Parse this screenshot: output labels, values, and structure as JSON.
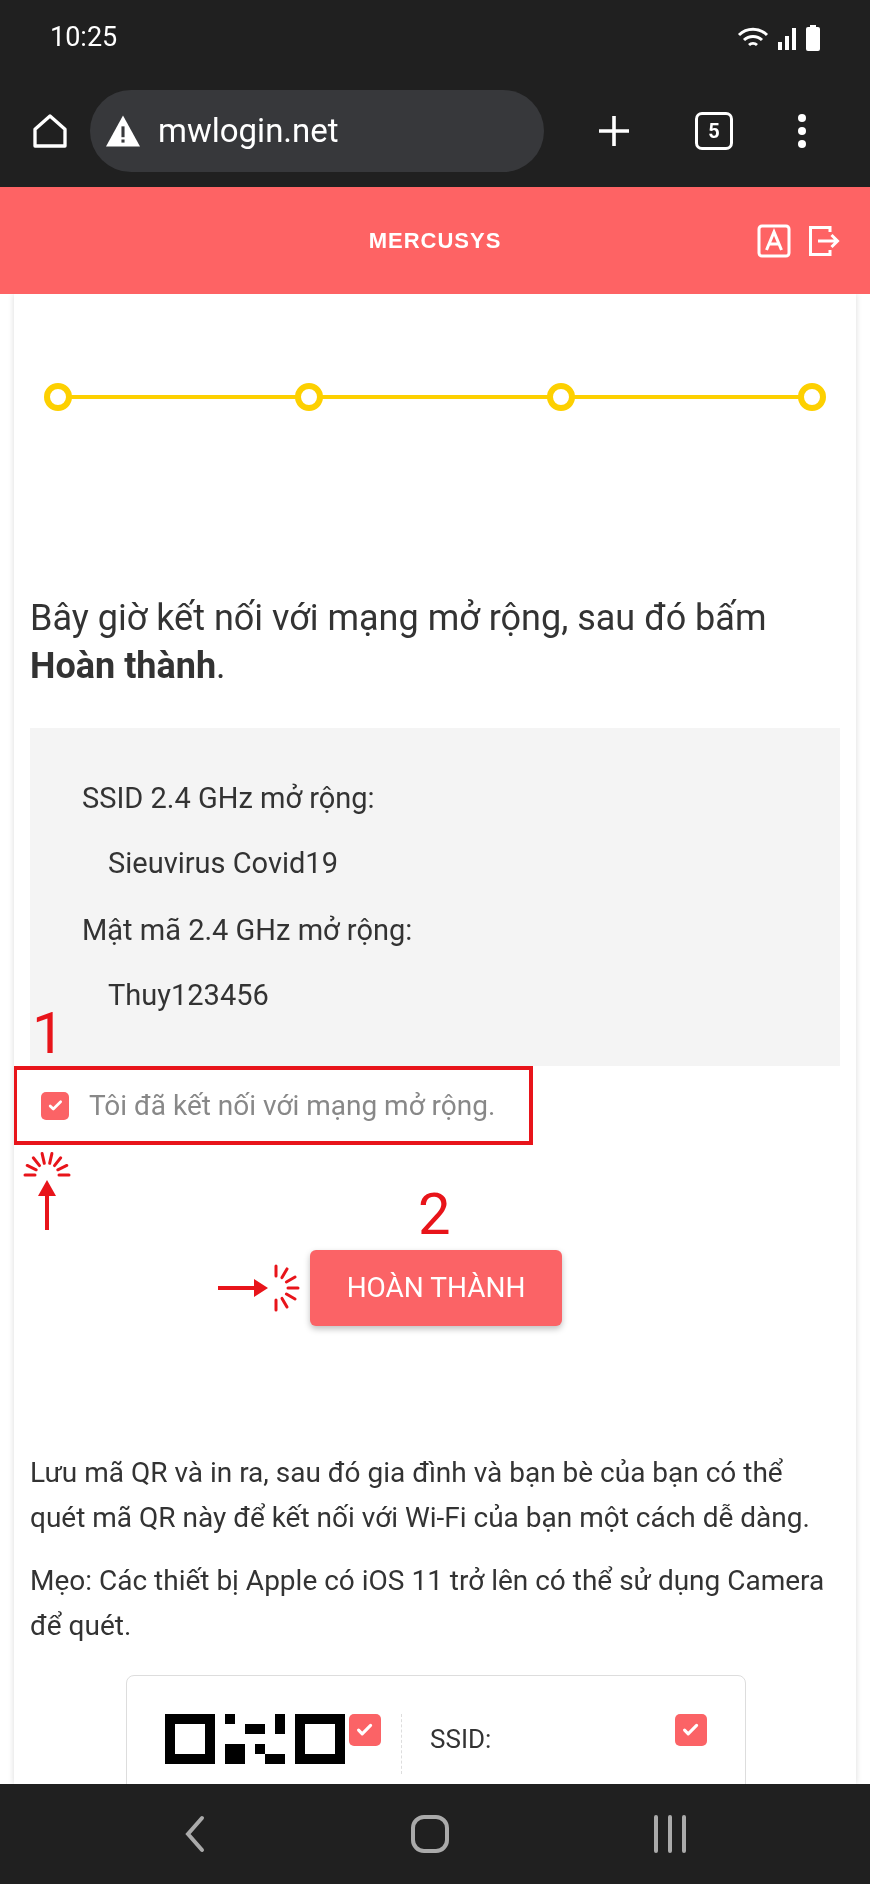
{
  "status_bar": {
    "time": "10:25"
  },
  "browser": {
    "url": "mwlogin.net",
    "tab_count": "5"
  },
  "header": {
    "logo": "MERCUSYS"
  },
  "progress": {
    "steps": [
      {
        "done": true
      },
      {
        "done": true
      },
      {
        "done": true
      },
      {
        "done": true
      }
    ]
  },
  "instruction": "Bây giờ kết nối với mạng mở rộng, sau đó bấm **Hoàn thành**.",
  "network_info": [
    {
      "label": "SSID 2.4 GHz mở rộng:",
      "value": "Sieuvirus Covid19"
    },
    {
      "label": "Mật mã 2.4 GHz mở rộng:",
      "value": "Thuy123456"
    }
  ],
  "annotations": {
    "step_1": "1",
    "step_2": "2"
  },
  "confirm_checkbox": {
    "label": "Tôi đã kết nối với mạng mở rộng.",
    "checked": true
  },
  "finish_button": "HOÀN THÀNH",
  "qr_text": "Lưu mã QR và in ra, sau đó gia đình và bạn bè của bạn có thể quét mã QR này để kết nối với Wi-Fi của bạn một cách dễ dàng.",
  "tip_text": "Mẹo: Các thiết bị Apple có iOS 11 trở lên có thể sử dụng Camera để quét.",
  "qr_card": {
    "qr_checked": true,
    "ssid_label": "SSID:",
    "ssid_checked": true
  }
}
